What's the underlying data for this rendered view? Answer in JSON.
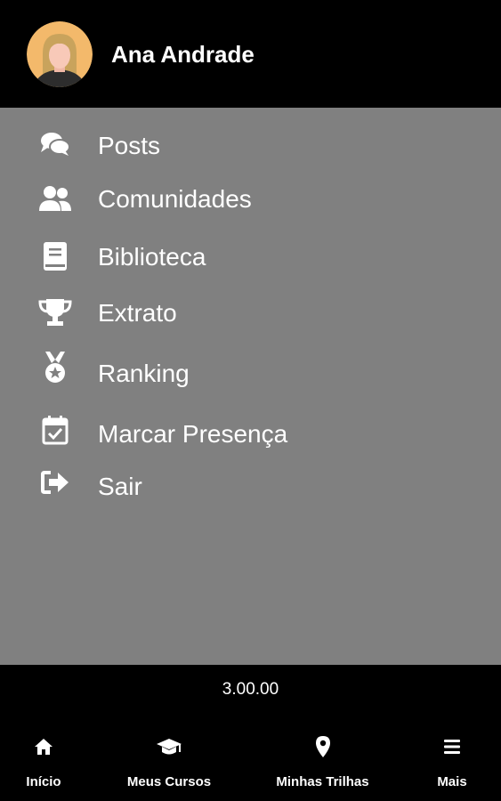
{
  "user": {
    "name": "Ana Andrade"
  },
  "menu": {
    "items": [
      {
        "label": "Posts",
        "icon": "comments-icon"
      },
      {
        "label": "Comunidades",
        "icon": "users-icon"
      },
      {
        "label": "Biblioteca",
        "icon": "book-icon"
      },
      {
        "label": "Extrato",
        "icon": "trophy-icon"
      },
      {
        "label": "Ranking",
        "icon": "medal-icon"
      },
      {
        "label": "Marcar Presença",
        "icon": "calendar-check-icon"
      },
      {
        "label": "Sair",
        "icon": "sign-out-icon"
      }
    ]
  },
  "footer": {
    "version": "3.00.00"
  },
  "tabs": [
    {
      "label": "Início",
      "icon": "home-icon"
    },
    {
      "label": "Meus Cursos",
      "icon": "graduation-cap-icon"
    },
    {
      "label": "Minhas Trilhas",
      "icon": "map-marker-icon"
    },
    {
      "label": "Mais",
      "icon": "menu-icon"
    }
  ],
  "colors": {
    "header_bg": "#000000",
    "menu_bg": "#808080",
    "text": "#ffffff",
    "avatar_bg": "#f3b96b"
  }
}
